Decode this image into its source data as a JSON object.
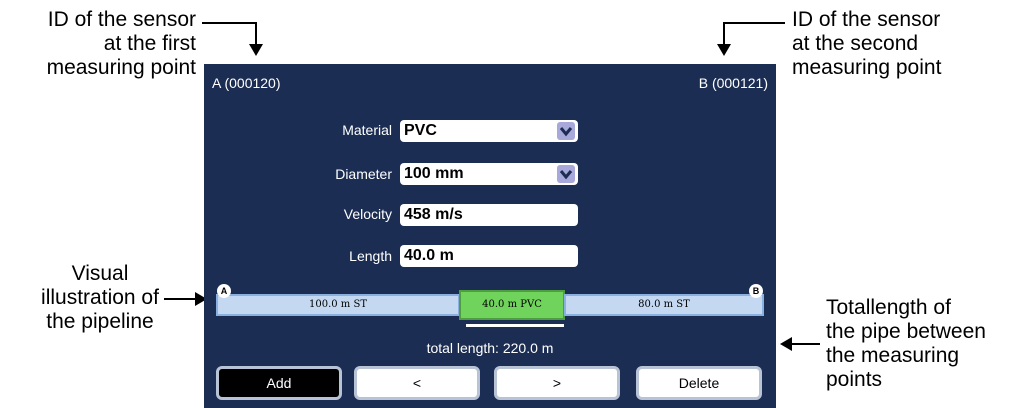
{
  "annotations": {
    "sensor_a": [
      "ID of the sensor",
      "at the first",
      "measuring point"
    ],
    "sensor_b": [
      "ID of the sensor",
      "at the second",
      "measuring point"
    ],
    "pipeline": [
      "Visual",
      "illustration of",
      "the pipeline"
    ],
    "total": [
      "Totallength of",
      "the pipe between",
      "the measuring",
      "points"
    ]
  },
  "header": {
    "sensor_a": "A (000120)",
    "sensor_b": "B (000121)"
  },
  "form": {
    "material": {
      "label": "Material",
      "value": "PVC"
    },
    "diameter": {
      "label": "Diameter",
      "value": "100 mm"
    },
    "velocity": {
      "label": "Velocity",
      "value": "458 m/s"
    },
    "length": {
      "label": "Length",
      "value": "40.0 m"
    }
  },
  "pipeline": {
    "node_a": "A",
    "node_b": "B",
    "segments": [
      {
        "label": "100.0 m ST",
        "selected": false
      },
      {
        "label": "40.0 m PVC",
        "selected": true
      },
      {
        "label": "80.0 m ST",
        "selected": false
      }
    ],
    "total": "total length: 220.0 m"
  },
  "buttons": {
    "add": "Add",
    "prev": "<",
    "next": ">",
    "delete": "Delete"
  },
  "colors": {
    "screen_bg": "#1c2d53",
    "pipe_st": "#c4d8f1",
    "pipe_pvc": "#6fd35c",
    "dropdown": "#a9a8da"
  },
  "icons": {
    "dropdown": "chevron-down-icon"
  }
}
